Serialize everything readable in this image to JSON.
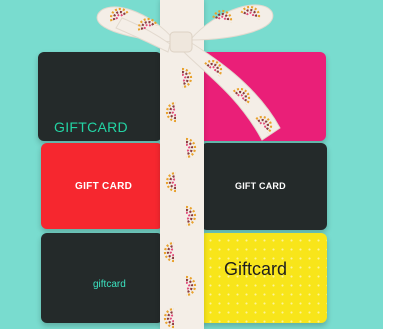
{
  "cards": {
    "top_left": {
      "label": "GIFTCARD",
      "color": "#242a2a",
      "text_color": "#23d4a4"
    },
    "top_right": {
      "label": "",
      "color": "#ea1f78"
    },
    "middle_left": {
      "label": "GIFT CARD",
      "color": "#f6272f",
      "text_color": "#ffffff"
    },
    "middle_right": {
      "label": "GIFT CARD",
      "color": "#242a2a",
      "text_color": "#ffffff"
    },
    "bottom_left": {
      "label": "giftcard",
      "color": "#242a2a",
      "text_color": "#3be2c0"
    },
    "bottom_right": {
      "label": "Giftcard",
      "color": "#f8e51a",
      "text_color": "#1e1e1e"
    }
  },
  "background_color": "#79dccf",
  "ribbon": {
    "color": "#f4eee7",
    "pattern_colors": [
      "#e8a12c",
      "#8a3b3f",
      "#e04a7a",
      "#b8284a"
    ]
  }
}
